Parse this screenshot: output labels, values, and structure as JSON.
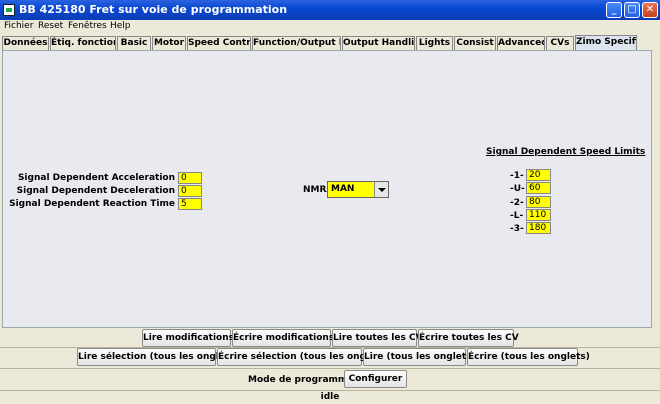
{
  "window": {
    "title": "BB 425180 Fret sur voie de programmation"
  },
  "menu": [
    "Fichier",
    "Reset",
    "Fenêtres",
    "Help"
  ],
  "tabs": [
    {
      "label": "Données"
    },
    {
      "label": "Étiq. fonctions"
    },
    {
      "label": "Basic"
    },
    {
      "label": "Motor"
    },
    {
      "label": "Speed Control"
    },
    {
      "label": "Function/Output Map"
    },
    {
      "label": "Output Handling"
    },
    {
      "label": "Lights"
    },
    {
      "label": "Consist"
    },
    {
      "label": "Advanced"
    },
    {
      "label": "CVs"
    },
    {
      "label": "Zimo Specific",
      "active": true
    }
  ],
  "signal": {
    "acceleration_label": "Signal Dependent Acceleration",
    "acceleration_value": "0",
    "deceleration_label": "Signal Dependent Deceleration",
    "deceleration_value": "0",
    "reaction_label": "Signal Dependent Reaction Time",
    "reaction_value": "5"
  },
  "nmra": {
    "label": "NMRA",
    "value": "MAN"
  },
  "speed_limits": {
    "heading": "Signal Dependent Speed Limits",
    "rows": [
      {
        "label": "-1-",
        "value": "20"
      },
      {
        "label": "-U-",
        "value": "60"
      },
      {
        "label": "-2-",
        "value": "80"
      },
      {
        "label": "-L-",
        "value": "110"
      },
      {
        "label": "-3-",
        "value": "180"
      }
    ]
  },
  "buttons_row1": {
    "read_changes": "Lire modifications",
    "write_changes": "Écrire modifications",
    "read_all_cv": "Lire toutes les CV",
    "write_all_cv": "Écrire toutes les CV"
  },
  "buttons_row2": {
    "read_selection_all": "Lire sélection (tous les onglets)",
    "write_selection_all": "Écrire sélection (tous les onglets)",
    "read_all": "Lire (tous les onglets)",
    "write_all": "Écrire (tous les onglets)"
  },
  "programming": {
    "label": "Mode de programmation",
    "configure": "Configurer"
  },
  "status": "idle"
}
